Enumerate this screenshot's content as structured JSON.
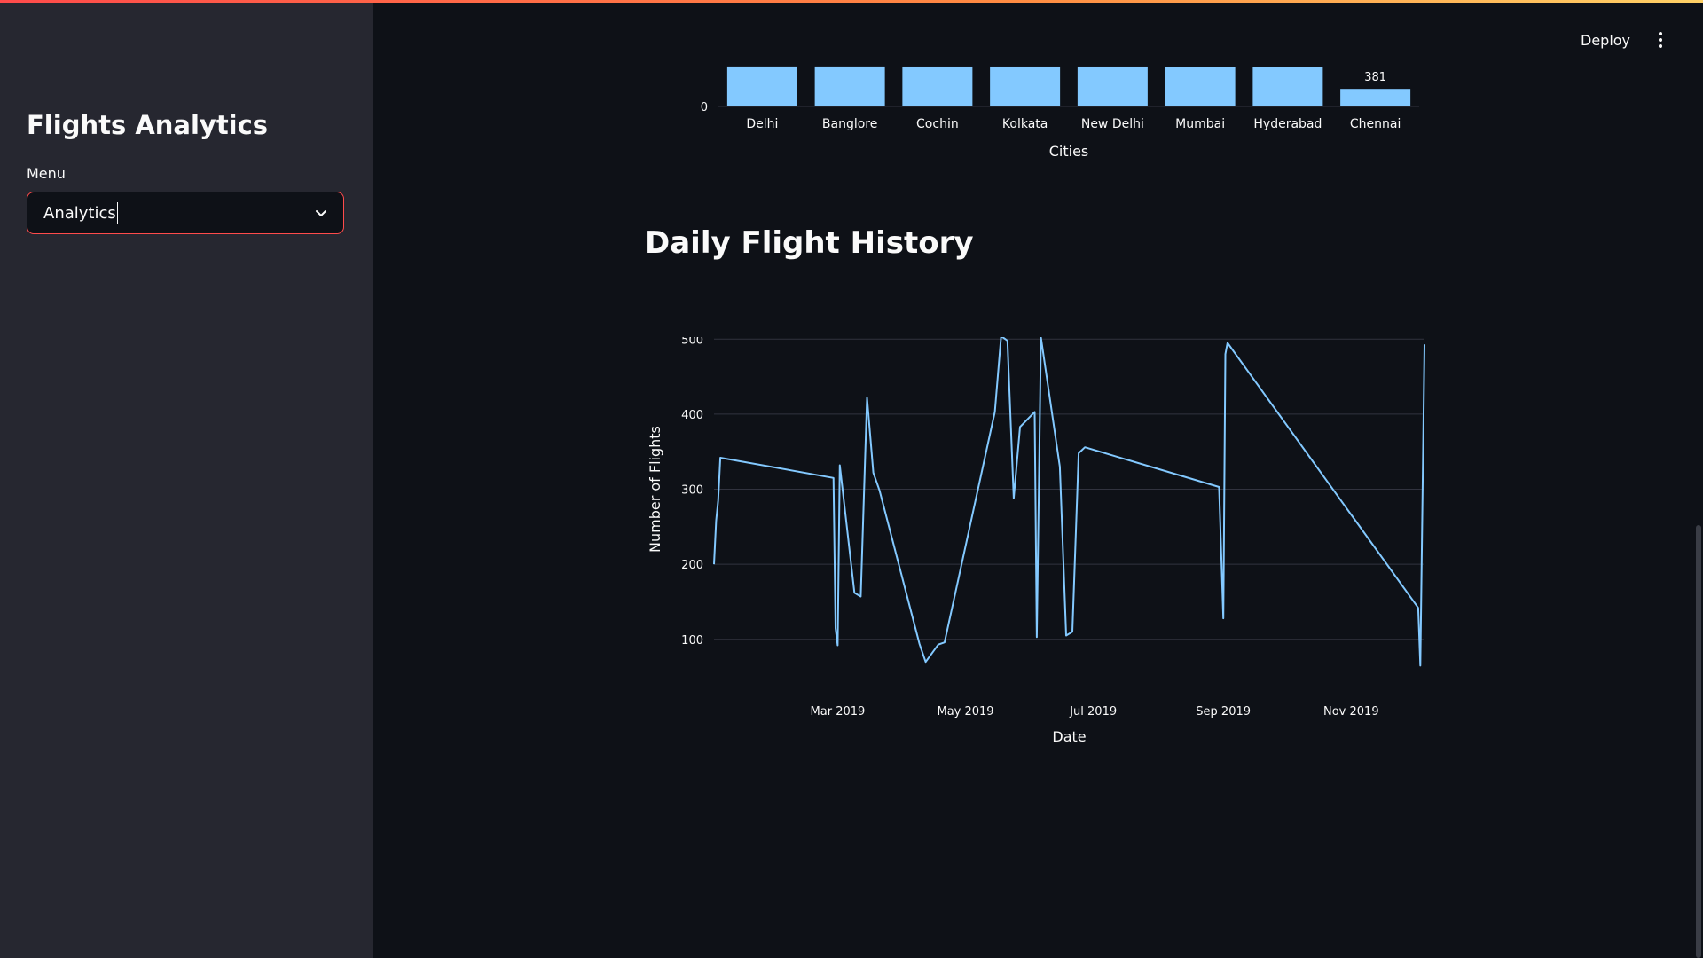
{
  "sidebar": {
    "title": "Flights Analytics",
    "menu_label": "Menu",
    "menu_value": "Analytics",
    "chevron_icon": "chevron-down-icon"
  },
  "header": {
    "deploy_label": "Deploy",
    "more_icon": "vertical-ellipsis-icon"
  },
  "colors": {
    "accent": "#ff4b4b",
    "series": "#83c9ff",
    "background": "#0e1117",
    "sidebar": "#262730"
  },
  "main": {
    "section_title": "Daily Flight History"
  },
  "chart_data": [
    {
      "type": "bar",
      "xlabel": "Cities",
      "ylabel": "",
      "categories": [
        "Delhi",
        "Banglore",
        "Cochin",
        "Kolkata",
        "New Delhi",
        "Mumbai",
        "Hyderabad",
        "Chennai"
      ],
      "values": [
        867,
        867,
        866,
        866,
        866,
        859,
        858,
        381
      ],
      "data_labels": [
        {
          "category": "Chennai",
          "text": "381"
        }
      ],
      "visible_y_ticks": [
        0
      ],
      "ylim_visible": [
        0,
        900
      ]
    },
    {
      "type": "line",
      "xlabel": "Date",
      "ylabel": "Number of Flights",
      "x_tick_labels": [
        "Mar 2019",
        "May 2019",
        "Jul 2019",
        "Sep 2019",
        "Nov 2019"
      ],
      "x_ticks": [
        "2019-03-01",
        "2019-05-01",
        "2019-07-01",
        "2019-09-01",
        "2019-11-01"
      ],
      "y_ticks": [
        100,
        200,
        300,
        400,
        500
      ],
      "xlim": [
        "2019-01-01",
        "2019-12-06"
      ],
      "ylim": [
        30,
        550
      ],
      "grid": true,
      "series": [
        {
          "points": [
            [
              "2019-01-01",
              200
            ],
            [
              "2019-01-02",
              258
            ],
            [
              "2019-01-03",
              285
            ],
            [
              "2019-01-04",
              342
            ],
            [
              "2019-02-27",
              315
            ],
            [
              "2019-02-28",
              115
            ],
            [
              "2019-03-01",
              92
            ],
            [
              "2019-03-02",
              332
            ],
            [
              "2019-03-09",
              162
            ],
            [
              "2019-03-12",
              157
            ],
            [
              "2019-03-15",
              422
            ],
            [
              "2019-03-18",
              322
            ],
            [
              "2019-03-21",
              298
            ],
            [
              "2019-04-09",
              94
            ],
            [
              "2019-04-12",
              70
            ],
            [
              "2019-04-18",
              93
            ],
            [
              "2019-04-21",
              96
            ],
            [
              "2019-05-15",
              403
            ],
            [
              "2019-05-18",
              504
            ],
            [
              "2019-05-21",
              498
            ],
            [
              "2019-05-24",
              288
            ],
            [
              "2019-05-27",
              383
            ],
            [
              "2019-06-03",
              403
            ],
            [
              "2019-06-04",
              103
            ],
            [
              "2019-06-06",
              502
            ],
            [
              "2019-06-15",
              330
            ],
            [
              "2019-06-18",
              105
            ],
            [
              "2019-06-21",
              110
            ],
            [
              "2019-06-24",
              348
            ],
            [
              "2019-06-27",
              356
            ],
            [
              "2019-08-30",
              303
            ],
            [
              "2019-09-01",
              128
            ],
            [
              "2019-09-02",
              480
            ],
            [
              "2019-09-03",
              495
            ],
            [
              "2019-12-03",
              142
            ],
            [
              "2019-12-04",
              65
            ],
            [
              "2019-12-06",
              493
            ]
          ]
        }
      ]
    }
  ]
}
